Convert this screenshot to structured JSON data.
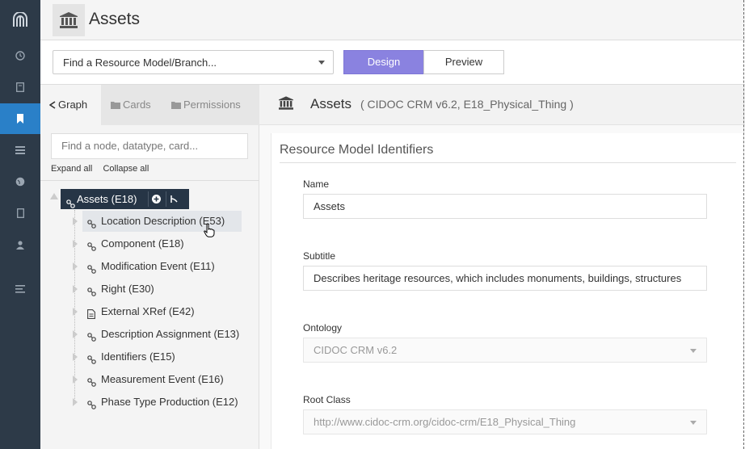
{
  "header": {
    "title": "Assets",
    "icon": "bank-icon"
  },
  "toolbar": {
    "model_select_placeholder": "Find a Resource Model/Branch...",
    "design_label": "Design",
    "preview_label": "Preview",
    "design_color": "#8a82e0"
  },
  "nav": {
    "items": [
      "logo-icon",
      "clock-icon",
      "book-icon",
      "bookmark-icon",
      "list-icon",
      "globe-icon",
      "file-icon",
      "user-icon",
      "lines-icon"
    ],
    "active": "bookmark-icon",
    "active_color": "#2a80c8"
  },
  "tree_panel": {
    "tabs": [
      {
        "label": "Graph",
        "icon": "share-icon",
        "active": true
      },
      {
        "label": "Cards",
        "icon": "folder-icon",
        "active": false
      },
      {
        "label": "Permissions",
        "icon": "folder-icon",
        "active": false
      }
    ],
    "search_placeholder": "Find a node, datatype, card...",
    "expand_all": "Expand all",
    "collapse_all": "Collapse all",
    "root": {
      "label": "Assets (E18)"
    },
    "nodes": [
      {
        "label": "Location Description (E53)",
        "icon": "link-icon"
      },
      {
        "label": "Component (E18)",
        "icon": "link-icon"
      },
      {
        "label": "Modification Event (E11)",
        "icon": "link-icon"
      },
      {
        "label": "Right (E30)",
        "icon": "link-icon"
      },
      {
        "label": "External XRef (E42)",
        "icon": "file-icon"
      },
      {
        "label": "Description Assignment (E13)",
        "icon": "link-icon"
      },
      {
        "label": "Identifiers (E15)",
        "icon": "link-icon"
      },
      {
        "label": "Measurement Event (E16)",
        "icon": "link-icon"
      },
      {
        "label": "Phase Type Production (E12)",
        "icon": "link-icon"
      }
    ]
  },
  "content": {
    "graph_title": "Assets",
    "graph_subtitle": "( CIDOC CRM v6.2, E18_Physical_Thing )",
    "section_title": "Resource Model Identifiers",
    "fields": {
      "name_label": "Name",
      "name_value": "Assets",
      "subtitle_label": "Subtitle",
      "subtitle_value": "Describes heritage resources, which includes monuments, buildings, structures",
      "ontology_label": "Ontology",
      "ontology_value": "CIDOC CRM v6.2",
      "root_class_label": "Root Class",
      "root_class_value": "http://www.cidoc-crm.org/cidoc-crm/E18_Physical_Thing"
    }
  }
}
